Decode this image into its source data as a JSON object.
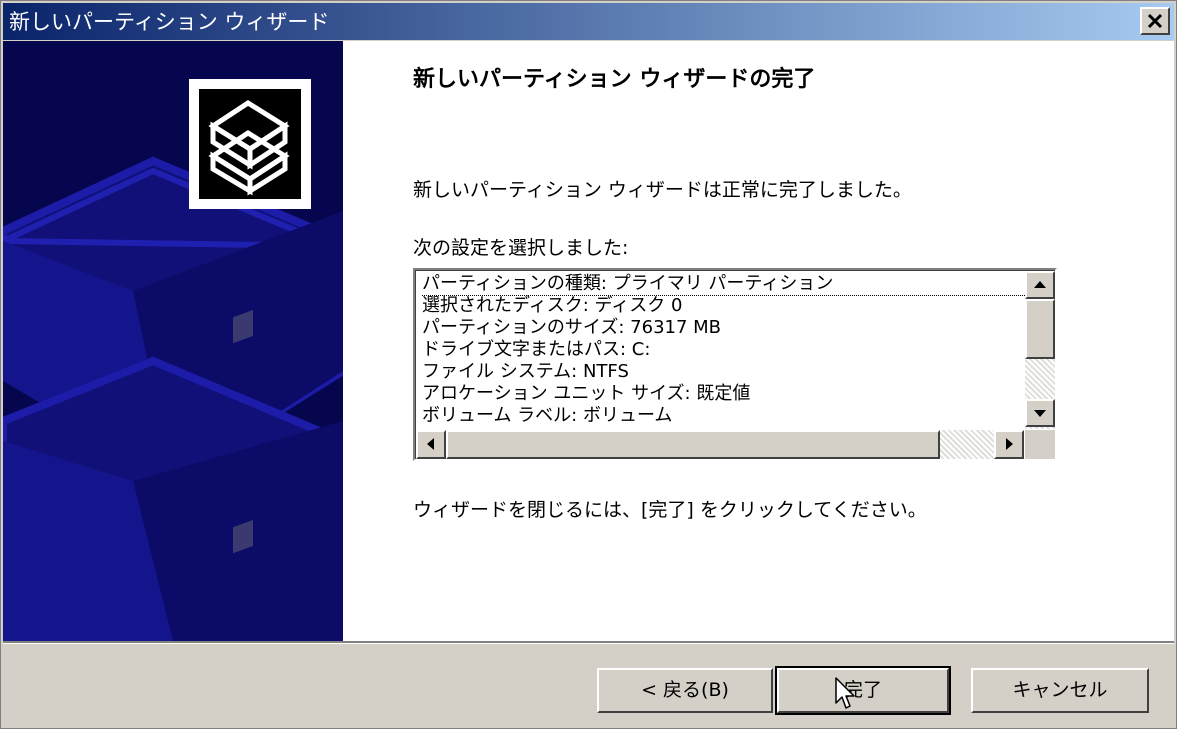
{
  "window": {
    "title": "新しいパーティション ウィザード"
  },
  "content": {
    "heading": "新しいパーティション ウィザードの完了",
    "success_message": "新しいパーティション ウィザードは正常に完了しました。",
    "settings_label": "次の設定を選択しました:",
    "settings": [
      "パーティションの種類: プライマリ パーティション",
      "選択されたディスク: ディスク 0",
      "パーティションのサイズ: 76317 MB",
      "ドライブ文字またはパス: C:",
      "ファイル システム: NTFS",
      "アロケーション ユニット サイズ: 既定値",
      "ボリューム ラベル: ボリューム"
    ],
    "close_instruction": "ウィザードを閉じるには、[完了] をクリックしてください。"
  },
  "buttons": {
    "back": "< 戻る(B)",
    "finish": "完了",
    "cancel": "キャンセル"
  },
  "icons": [
    "close-icon",
    "disk-stack-icon",
    "scroll-up-icon",
    "scroll-down-icon",
    "scroll-left-icon",
    "scroll-right-icon",
    "mouse-cursor-icon"
  ]
}
